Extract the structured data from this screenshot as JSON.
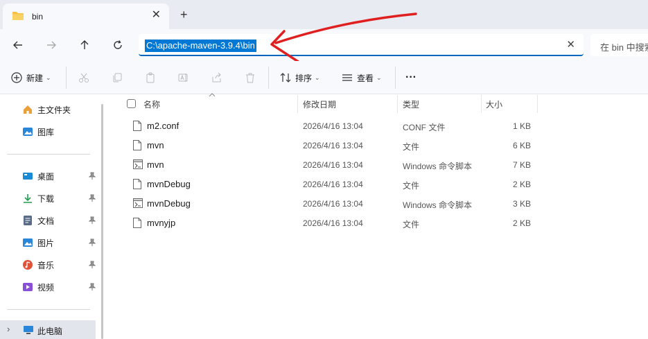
{
  "tab": {
    "title": "bin",
    "close": "✕",
    "new_tab": "+"
  },
  "address": {
    "path": "C:\\apache-maven-3.9.4\\bin",
    "clear": "✕"
  },
  "search": {
    "placeholder": "在 bin 中搜索"
  },
  "toolbar": {
    "new_label": "新建",
    "sort_label": "排序",
    "view_label": "查看",
    "more_label": "···"
  },
  "sidebar": {
    "top": [
      {
        "label": "主文件夹",
        "icon": "home-icon"
      },
      {
        "label": "图库",
        "icon": "gallery-icon"
      }
    ],
    "pinned": [
      {
        "label": "桌面",
        "icon": "desktop-icon",
        "color": "#1a8ad4"
      },
      {
        "label": "下载",
        "icon": "download-icon",
        "color": "#1f9e4c"
      },
      {
        "label": "文档",
        "icon": "document-icon",
        "color": "#5a6b85"
      },
      {
        "label": "图片",
        "icon": "pictures-icon",
        "color": "#2a86d8"
      },
      {
        "label": "音乐",
        "icon": "music-icon",
        "color": "#e0533a"
      },
      {
        "label": "视频",
        "icon": "video-icon",
        "color": "#8a4fd8"
      }
    ],
    "this_pc": {
      "label": "此电脑",
      "chevron": "›"
    }
  },
  "columns": {
    "name": "名称",
    "modified": "修改日期",
    "type": "类型",
    "size": "大小"
  },
  "files": [
    {
      "name": "m2.conf",
      "modified": "2026/4/16 13:04",
      "type": "CONF 文件",
      "size": "1 KB",
      "icon": "file-icon"
    },
    {
      "name": "mvn",
      "modified": "2026/4/16 13:04",
      "type": "文件",
      "size": "6 KB",
      "icon": "file-icon"
    },
    {
      "name": "mvn",
      "modified": "2026/4/16 13:04",
      "type": "Windows 命令脚本",
      "size": "7 KB",
      "icon": "script-icon"
    },
    {
      "name": "mvnDebug",
      "modified": "2026/4/16 13:04",
      "type": "文件",
      "size": "2 KB",
      "icon": "file-icon"
    },
    {
      "name": "mvnDebug",
      "modified": "2026/4/16 13:04",
      "type": "Windows 命令脚本",
      "size": "3 KB",
      "icon": "script-icon"
    },
    {
      "name": "mvnyjp",
      "modified": "2026/4/16 13:04",
      "type": "文件",
      "size": "2 KB",
      "icon": "file-icon"
    }
  ],
  "colors": {
    "accent": "#0078d4",
    "annotation": "#e02020",
    "folder": "#f6c144"
  }
}
